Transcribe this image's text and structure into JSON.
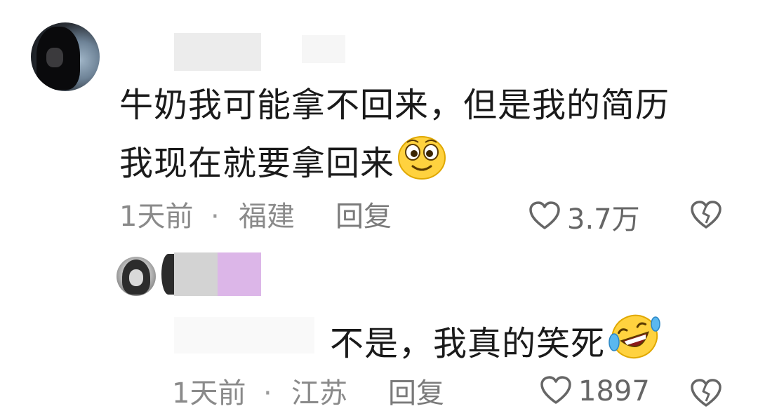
{
  "comment": {
    "line1": "牛奶我可能拿不回来，但是我的简历",
    "line2": "我现在就要拿回来",
    "emoji": "smile-emoji",
    "time": "1天前",
    "separator": "·",
    "location": "福建",
    "reply_label": "回复",
    "like_count": "3.7万"
  },
  "reply": {
    "text": "不是，我真的笑死",
    "emoji": "rofl-emoji",
    "time": "1天前",
    "separator": "·",
    "location": "江苏",
    "reply_label": "回复",
    "like_count": "1897"
  },
  "colors": {
    "text": "#1a1a1a",
    "meta": "#8a8a8a",
    "redact_gray": "#d3d3d3",
    "redact_purple": "#dcb6e8",
    "emoji_yellow": "#ffd23f"
  }
}
